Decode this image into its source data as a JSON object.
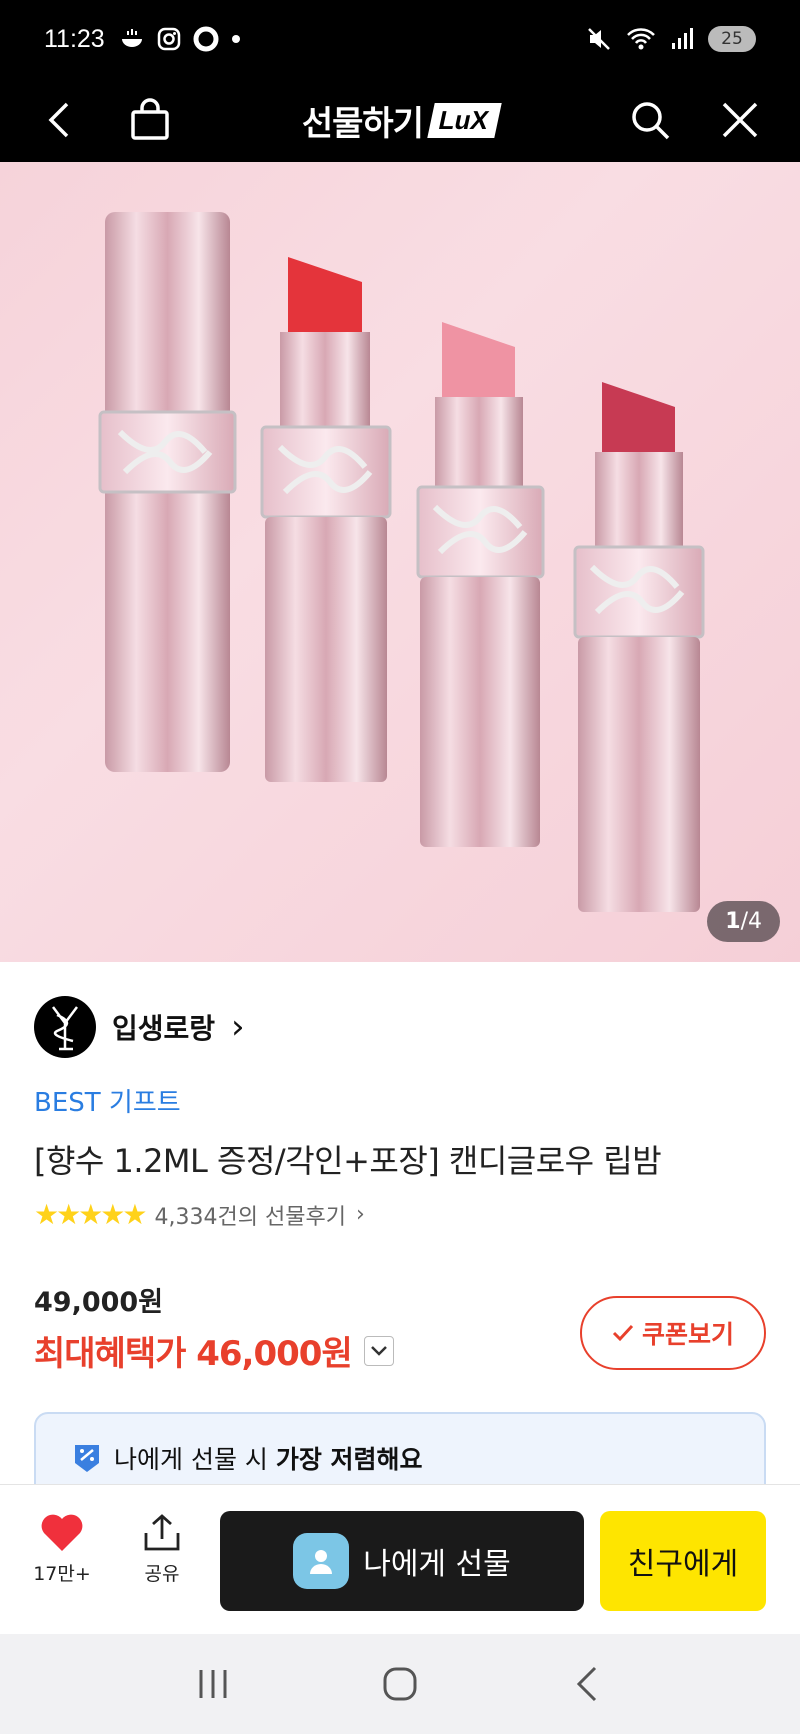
{
  "status_bar": {
    "time": "11:23",
    "battery": "25"
  },
  "header": {
    "title": "선물하기",
    "badge": "LuX"
  },
  "hero": {
    "counter_current": "1",
    "counter_total": "/4"
  },
  "brand": {
    "name": "입생로랑",
    "chevron": "›"
  },
  "product": {
    "badge": "BEST 기프트",
    "title": "[향수 1.2ML 증정/각인+포장] 캔디글로우 립밤",
    "rating": 5,
    "review_text": "4,334건의 선물후기",
    "review_chevron": "›"
  },
  "price": {
    "original": "49,000원",
    "best_label": "최대혜택가 46,000원",
    "coupon_label": "쿠폰보기"
  },
  "notice": {
    "prefix": "나에게 선물 시 ",
    "emphasis": "가장 저렴해요"
  },
  "actions": {
    "like_count": "17만+",
    "share_label": "공유",
    "gift_me_label": "나에게 선물",
    "gift_friend_label": "친구에게"
  },
  "colors": {
    "accent_red": "#e8402c",
    "kakao_yellow": "#fee500",
    "best_blue": "#2a7de1"
  },
  "icons": [
    "back-icon",
    "bag-icon",
    "search-icon",
    "close-icon",
    "heart-icon",
    "share-icon",
    "user-icon",
    "check-icon",
    "chevron-down-icon",
    "coupon-icon"
  ]
}
